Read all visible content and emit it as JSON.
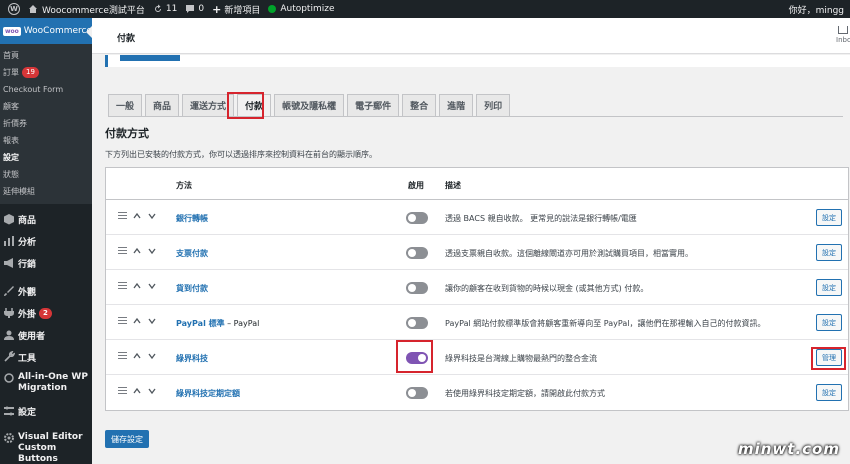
{
  "admin_bar": {
    "site_name": "Woocommerce測試平台",
    "updates_count": "11",
    "comments_count": "0",
    "new_item": "新增項目",
    "autoptimize": "Autoptimize",
    "greeting": "你好，mingg"
  },
  "sidebar": {
    "current": "WooCommerce",
    "woo_badge": "woo",
    "submenu": [
      {
        "label": "首頁"
      },
      {
        "label": "訂單",
        "badge": "19"
      },
      {
        "label": "Checkout Form"
      },
      {
        "label": "顧客"
      },
      {
        "label": "折價券"
      },
      {
        "label": "報表"
      },
      {
        "label": "設定"
      },
      {
        "label": "狀態"
      },
      {
        "label": "延伸模組"
      }
    ],
    "menu": [
      {
        "label": "商品",
        "icon": "box-icon"
      },
      {
        "label": "分析",
        "icon": "bar-chart-icon"
      },
      {
        "label": "行銷",
        "icon": "megaphone-icon"
      },
      {
        "label": "外觀",
        "icon": "paintbrush-icon"
      },
      {
        "label": "外掛",
        "icon": "plug-icon",
        "badge": "2"
      },
      {
        "label": "使用者",
        "icon": "user-icon"
      },
      {
        "label": "工具",
        "icon": "wrench-icon"
      },
      {
        "label": "All-in-One WP Migration",
        "icon": "migration-icon"
      },
      {
        "label": "設定",
        "icon": "settings-icon"
      },
      {
        "label": "Visual Editor Custom Buttons",
        "icon": "gear-icon"
      }
    ]
  },
  "header": {
    "title": "付款",
    "inbox": "Inbo"
  },
  "tabs": [
    "一般",
    "商品",
    "運送方式",
    "付款",
    "帳號及隱私權",
    "電子郵件",
    "整合",
    "進階",
    "列印"
  ],
  "section": {
    "title": "付款方式",
    "description": "下方列出已安裝的付款方式，你可以透過排序來控制資料在前台的顯示順序。"
  },
  "table": {
    "headers": {
      "method": "方法",
      "enabled": "啟用",
      "description": "描述"
    },
    "rows": [
      {
        "name": "銀行轉帳",
        "suffix": "",
        "enabled": false,
        "description": "透過 BACS 親自收款。 更常見的說法是銀行轉帳/電匯",
        "action": "設定"
      },
      {
        "name": "支票付款",
        "suffix": "",
        "enabled": false,
        "description": "透過支票親自收款。這個離線閘道亦可用於測試購買項目，相當實用。",
        "action": "設定"
      },
      {
        "name": "貨到付款",
        "suffix": "",
        "enabled": false,
        "description": "讓你的顧客在收到貨物的時候以現金 (或其他方式) 付款。",
        "action": "設定"
      },
      {
        "name": "PayPal 標準",
        "suffix": " – PayPal",
        "enabled": false,
        "description": "PayPal 網站付款標準版會將顧客重新導向至 PayPal，讓他們在那裡輸入自己的付款資訊。",
        "action": "設定"
      },
      {
        "name": "綠界科技",
        "suffix": "",
        "enabled": true,
        "description": "綠界科技是台灣線上購物最熱門的整合金流",
        "action": "管理"
      },
      {
        "name": "綠界科技定期定額",
        "suffix": "",
        "enabled": false,
        "description": "若使用綠界科技定期定額，請開啟此付款方式",
        "action": "設定"
      }
    ]
  },
  "save_label": "儲存設定",
  "watermark": "minwt.com",
  "colors": {
    "accent": "#2271b1",
    "toggle_on": "#7f54b3",
    "highlight": "#d6242d",
    "sidebar": "#1d2327"
  }
}
